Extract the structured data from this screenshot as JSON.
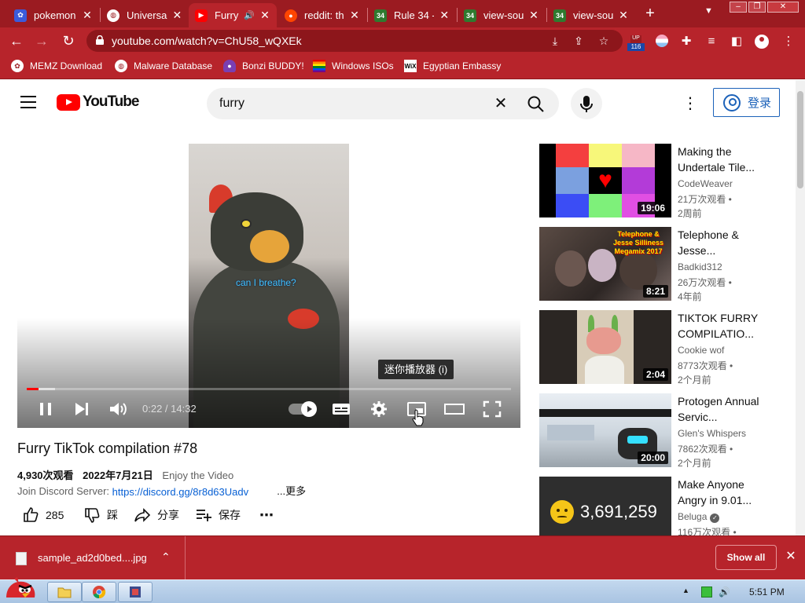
{
  "browser": {
    "tabs": [
      {
        "title": "pokemon",
        "icon": "paw-icon",
        "icon_color": "#3b5bdb"
      },
      {
        "title": "Universal",
        "icon": "globe-icon",
        "icon_color": "#ffffff"
      },
      {
        "title": "Furry",
        "icon": "youtube-icon",
        "icon_color": "#ff0000",
        "active": true
      },
      {
        "title": "reddit: th",
        "icon": "reddit-icon",
        "icon_color": "#ff4500"
      },
      {
        "title": "Rule 34 -",
        "icon": "r34-icon",
        "icon_color": "#2f7a2f"
      },
      {
        "title": "view-sou",
        "icon": "r34-icon",
        "icon_color": "#2f7a2f"
      },
      {
        "title": "view-sou",
        "icon": "r34-icon",
        "icon_color": "#2f7a2f"
      }
    ],
    "tab_icon_text": "34",
    "url": "youtube.com/watch?v=ChU58_wQXEk",
    "ext_badge_top": "UP",
    "ext_badge_count": "116",
    "bookmarks": [
      {
        "label": "MEMZ Download",
        "icon": "paw-icon"
      },
      {
        "label": "Malware Database",
        "icon": "globe-icon"
      },
      {
        "label": "Bonzi BUDDY!",
        "icon": "bonzi-icon"
      },
      {
        "label": "Windows ISOs",
        "icon": "rainbow-flag-icon"
      },
      {
        "label": "Egyptian Embassy",
        "icon": "wix-icon"
      }
    ],
    "wix_text": "WiX"
  },
  "youtube": {
    "logo_text": "YouTube",
    "search_value": "furry",
    "signin_label": "登录"
  },
  "player": {
    "caption": "can I breathe?",
    "time": "0:22 / 14:32",
    "progress": 0.025,
    "buffered": 0.058,
    "tooltip": "迷你播放器 (i)"
  },
  "video": {
    "title": "Furry TikTok compilation #78",
    "views": "4,930次观看",
    "date": "2022年7月21日",
    "tagline": "Enjoy the Video",
    "desc_prefix": "Join Discord Server:",
    "desc_link": "https://discord.gg/8r8d63Uadv",
    "more_label": "...更多",
    "likes": "285",
    "dislike_label": "踩",
    "share_label": "分享",
    "save_label": "保存"
  },
  "related": [
    {
      "title": "Making the Undertale Tile...",
      "channel": "CodeWeaver",
      "views": "21万次观看 •",
      "age": "2周前",
      "duration": "19:06"
    },
    {
      "title": "Telephone & Jesse...",
      "channel": "Badkid312",
      "views": "26万次观看 •",
      "age": "4年前",
      "duration": "8:21",
      "thumb_text": "Telephone & Jesse Silliness Megamix 2017"
    },
    {
      "title": "TIKTOK FURRY COMPILATIO...",
      "channel": "Cookie wof",
      "views": "8773次观看 •",
      "age": "2个月前",
      "duration": "2:04"
    },
    {
      "title": "Protogen Annual Servic...",
      "channel": "Glen's Whispers",
      "views": "7862次观看 •",
      "age": "2个月前",
      "duration": "20:00"
    },
    {
      "title": "Make Anyone Angry in 9.01...",
      "channel": "Beluga",
      "views": "116万次观看 •",
      "verified": true,
      "thumb_text": "3,691,259"
    }
  ],
  "downloads": {
    "file": "sample_ad2d0bed....jpg",
    "show_all": "Show all"
  },
  "taskbar": {
    "clock": "5:51 PM"
  },
  "colors": {
    "chrome_red": "#b7242b",
    "chrome_dark": "#9b1b21",
    "yt_red": "#ff0000",
    "link_blue": "#065fd4"
  }
}
